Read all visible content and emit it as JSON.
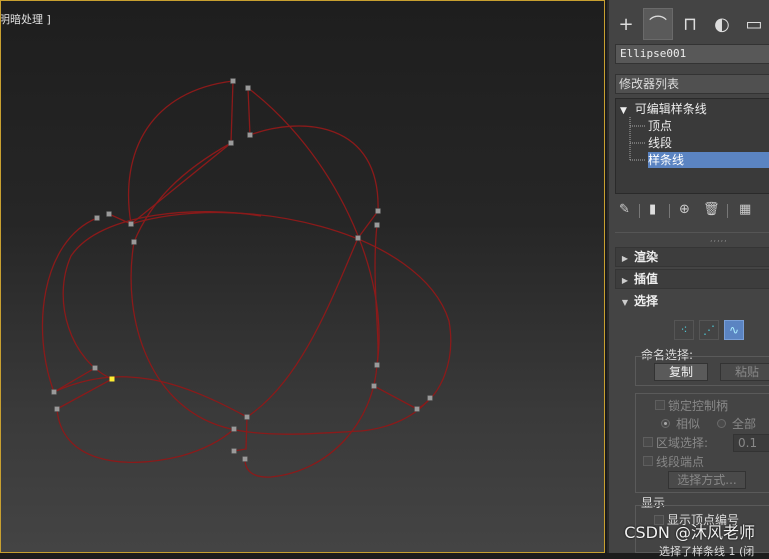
{
  "viewport": {
    "label": "明暗处理 ]",
    "spline_color": "#8b1a1a",
    "vertex_color": "#9a9a9a",
    "selected_vertex_color": "#ffee33"
  },
  "panel": {
    "tabs": [
      {
        "icon": "create-icon",
        "glyph": "+"
      },
      {
        "icon": "modify-icon",
        "glyph": "⌒"
      },
      {
        "icon": "hierarchy-icon",
        "glyph": "⊓"
      },
      {
        "icon": "motion-icon",
        "glyph": "◐"
      },
      {
        "icon": "display-icon",
        "glyph": "▭"
      }
    ],
    "object_name": "Ellipse001",
    "modifier_list": "修改器列表",
    "stack": {
      "root": "可编辑样条线",
      "items": [
        "顶点",
        "线段",
        "样条线"
      ],
      "selected": "样条线"
    },
    "rollouts": {
      "render": "渲染",
      "interp": "插值",
      "selection": "选择"
    },
    "selection": {
      "named_selection": "命名选择:",
      "copy": "复制",
      "paste": "粘贴",
      "lock_handles": "锁定控制柄",
      "similar": "相似",
      "all": "全部",
      "area_select": "区域选择:",
      "area_value": "0.1",
      "segment_end": "线段端点",
      "select_by": "选择方式...",
      "display": "显示",
      "show_vertex_numbers": "显示顶点编号",
      "bottom_text": "选择了样条线 1 (闭"
    }
  },
  "watermark": "CSDN @沐风老师"
}
